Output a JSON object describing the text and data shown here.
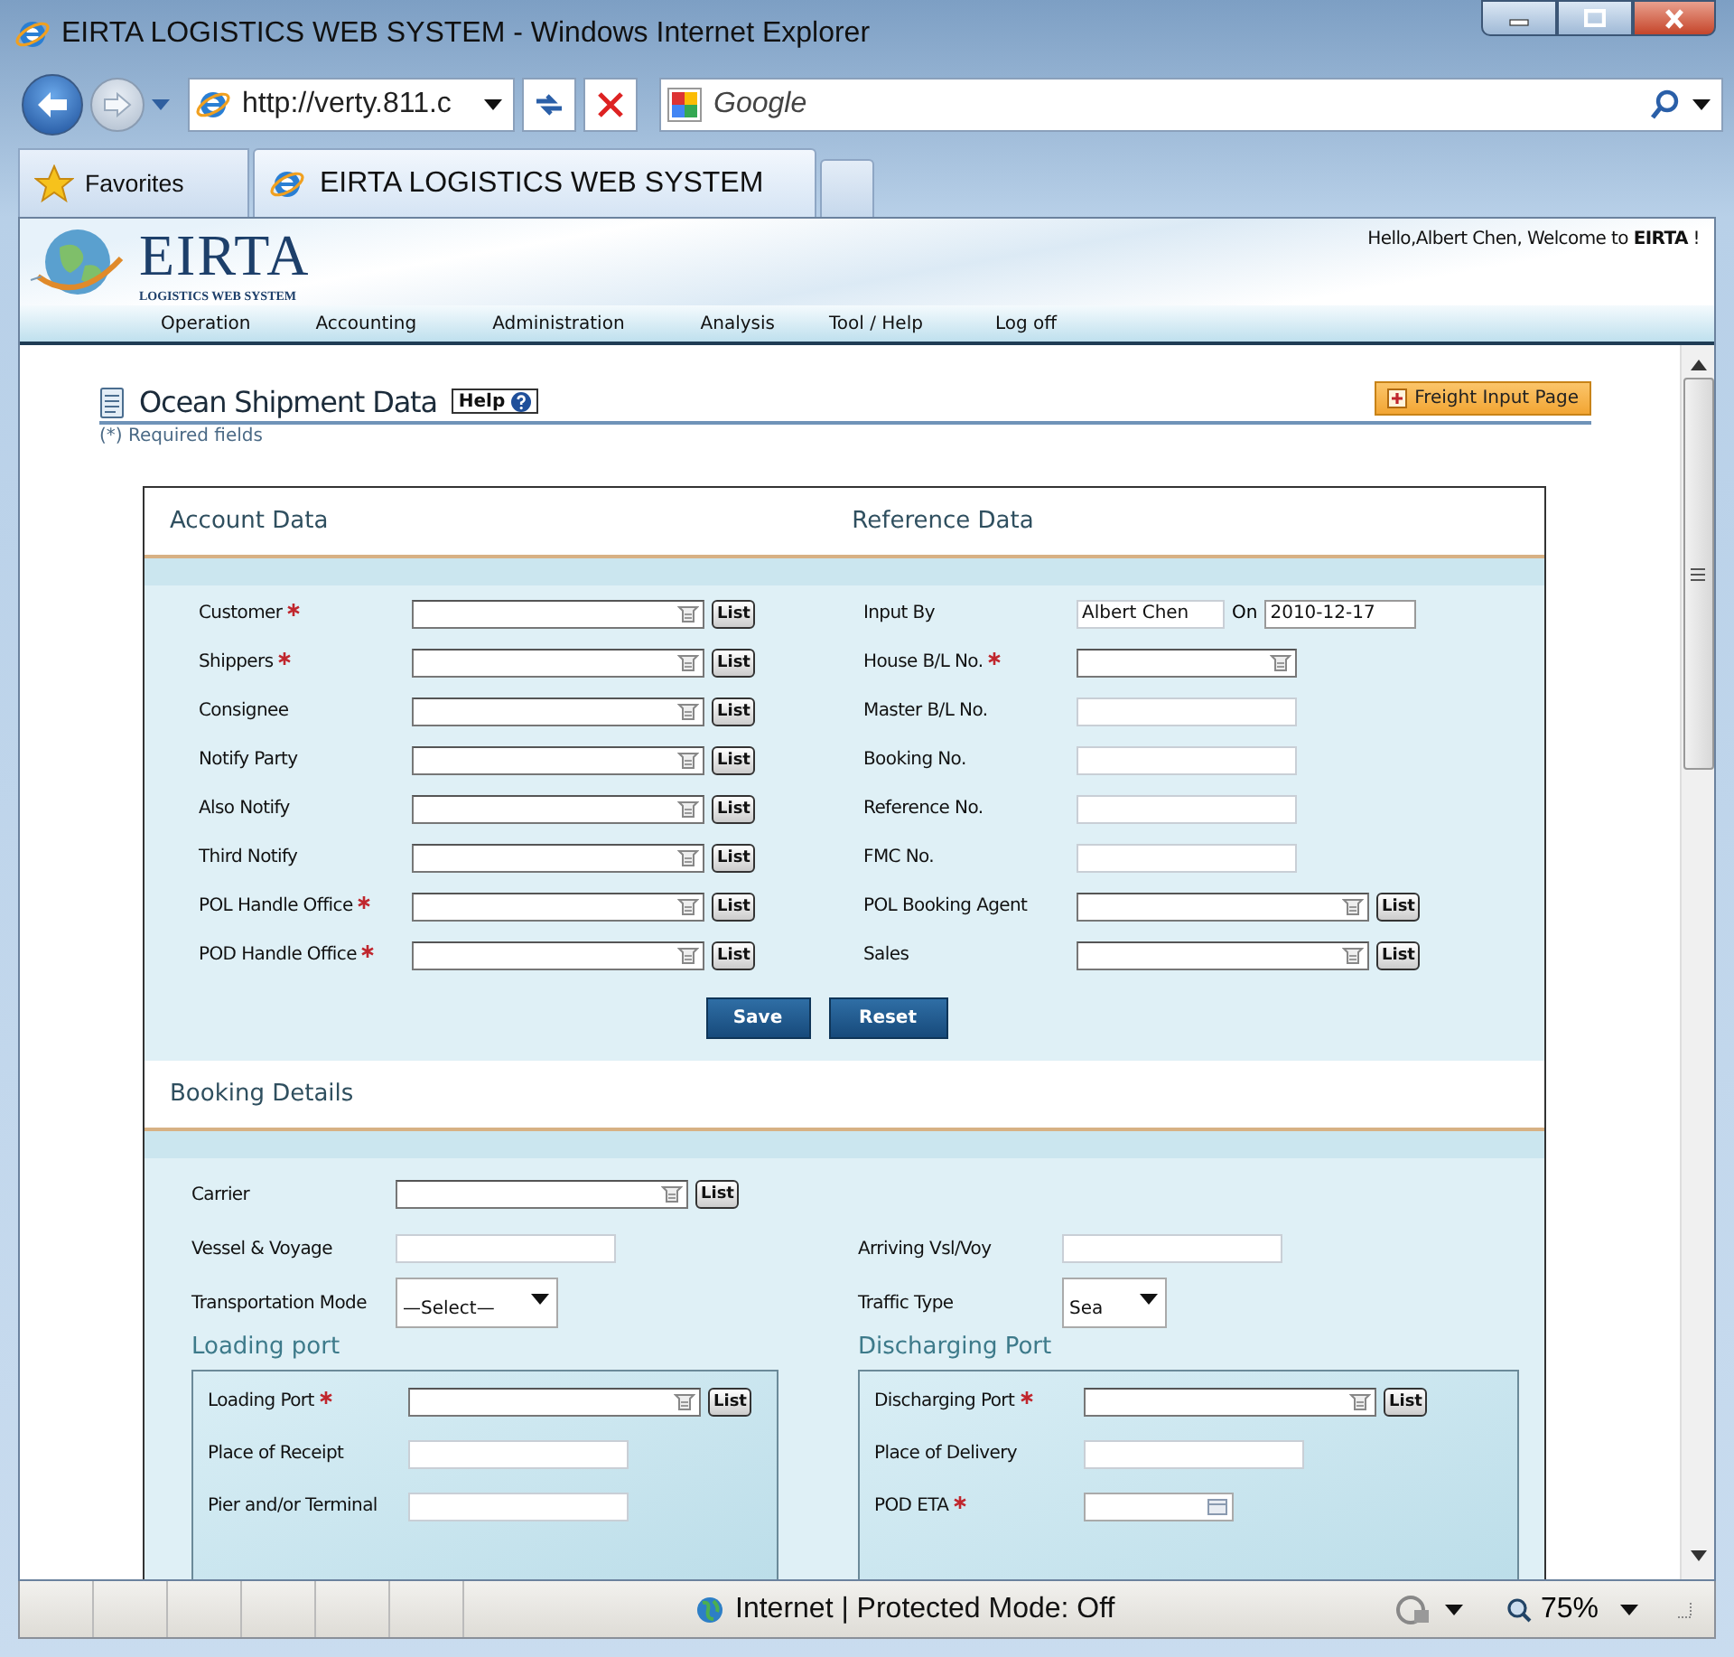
{
  "window": {
    "title": "EIRTA LOGISTICS WEB SYSTEM - Windows Internet Explorer"
  },
  "address_bar": {
    "url": "http://verty.811.c"
  },
  "search_box": {
    "placeholder": "Google"
  },
  "favorites": {
    "label": "Favorites"
  },
  "tabs": [
    {
      "label": "EIRTA LOGISTICS WEB SYSTEM",
      "selected": true
    }
  ],
  "site": {
    "logo": "EIRTA",
    "logo_subtitle": "LOGISTICS WEB SYSTEM",
    "greeting": "Hello,Albert Chen, Welcome to **EIRTA** !",
    "menu": [
      "Operation",
      "Accounting",
      "Administration",
      "Analysis",
      "Tool / Help",
      "Log off"
    ]
  },
  "page": {
    "title": "Ocean Shipment Data",
    "help_button": "Help",
    "action_button": "Freight Input Page",
    "required_note": "(*) Required fields"
  },
  "account_section": {
    "headings": [
      "Account Data",
      "Reference Data"
    ],
    "rows": [
      {
        "left": {
          "label": "Customer",
          "required": true,
          "kind": "lookup",
          "button": "List"
        },
        "right": {
          "label": "Input By",
          "required": false,
          "kind": "text_on",
          "value": "Albert Chen",
          "on_label": "On",
          "on_value": "2010-12-17"
        }
      },
      {
        "left": {
          "label": "Shippers",
          "required": true,
          "kind": "lookup",
          "button": "List"
        },
        "right": {
          "label": "House B/L No.",
          "required": true,
          "kind": "lookup"
        }
      },
      {
        "left": {
          "label": "Consignee",
          "required": false,
          "kind": "lookup",
          "button": "List"
        },
        "right": {
          "label": "Master B/L No.",
          "required": false,
          "kind": "text"
        }
      },
      {
        "left": {
          "label": "Notify Party",
          "required": false,
          "kind": "lookup",
          "button": "List"
        },
        "right": {
          "label": "Booking No.",
          "required": false,
          "kind": "text"
        }
      },
      {
        "left": {
          "label": "Also Notify",
          "required": false,
          "kind": "lookup",
          "button": "List"
        },
        "right": {
          "label": "Reference No.",
          "required": false,
          "kind": "text"
        }
      },
      {
        "left": {
          "label": "Third Notify",
          "required": false,
          "kind": "lookup",
          "button": "List"
        },
        "right": {
          "label": "FMC No.",
          "required": false,
          "kind": "text"
        }
      },
      {
        "left": {
          "label": "POL Handle Office",
          "required": true,
          "kind": "lookup",
          "button": "List"
        },
        "right": {
          "label": "POL Booking Agent",
          "required": false,
          "kind": "lookup",
          "button": "List"
        }
      },
      {
        "left": {
          "label": "POD Handle Office",
          "required": true,
          "kind": "lookup",
          "button": "List"
        },
        "right": {
          "label": "Sales",
          "required": false,
          "kind": "lookup",
          "button": "List"
        }
      }
    ],
    "buttons": [
      "Save",
      "Reset"
    ]
  },
  "booking_section": {
    "heading": "Booking Details",
    "rows": [
      {
        "left": {
          "label": "Carrier",
          "required": false,
          "kind": "lookup",
          "button": "List"
        }
      },
      {
        "left": {
          "label": "Vessel & Voyage",
          "required": false,
          "kind": "text"
        },
        "right": {
          "label": "Arriving Vsl/Voy",
          "required": false,
          "kind": "text"
        }
      },
      {
        "left": {
          "label": "Transportation Mode",
          "required": false,
          "kind": "select",
          "value": "—Select—"
        },
        "right": {
          "label": "Traffic Type",
          "required": false,
          "kind": "select",
          "value": "Sea"
        }
      }
    ],
    "panels": [
      {
        "heading": "Loading port",
        "rows": [
          {
            "label": "Loading Port",
            "required": true,
            "kind": "lookup",
            "button": "List"
          },
          {
            "label": "Place of Receipt",
            "required": false,
            "kind": "text"
          },
          {
            "label": "Pier and/or Terminal",
            "required": false,
            "kind": "text"
          }
        ]
      },
      {
        "heading": "Discharging Port",
        "rows": [
          {
            "label": "Discharging Port",
            "required": true,
            "kind": "lookup",
            "button": "List"
          },
          {
            "label": "Place of Delivery",
            "required": false,
            "kind": "text"
          },
          {
            "label": "POD ETA",
            "required": true,
            "kind": "date"
          }
        ]
      }
    ]
  },
  "status_bar": {
    "text": "Internet | Protected Mode: Off",
    "zoom": "75%"
  }
}
